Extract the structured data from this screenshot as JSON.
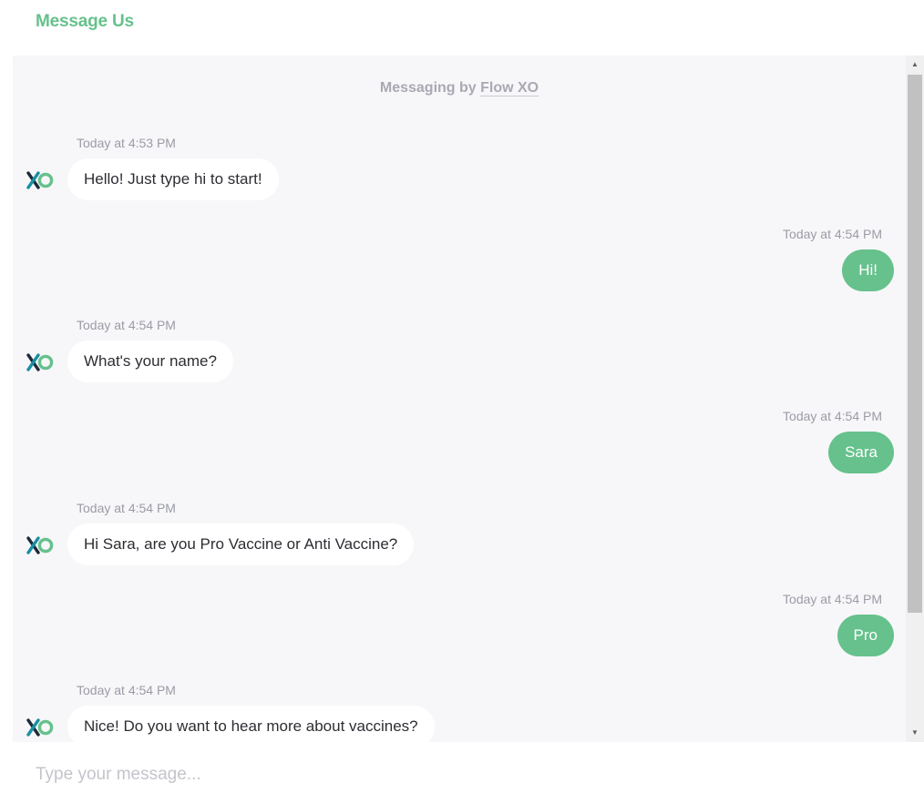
{
  "header": {
    "title": "Message Us"
  },
  "chat": {
    "powered_prefix": "Messaging by ",
    "powered_brand": "Flow XO",
    "messages": [
      {
        "sender": "bot",
        "timestamp": "Today at 4:53 PM",
        "text": "Hello! Just type hi to start!"
      },
      {
        "sender": "user",
        "timestamp": "Today at 4:54 PM",
        "text": "Hi!"
      },
      {
        "sender": "bot",
        "timestamp": "Today at 4:54 PM",
        "text": "What's your name?"
      },
      {
        "sender": "user",
        "timestamp": "Today at 4:54 PM",
        "text": "Sara"
      },
      {
        "sender": "bot",
        "timestamp": "Today at 4:54 PM",
        "text": "Hi Sara, are you Pro Vaccine or Anti Vaccine?"
      },
      {
        "sender": "user",
        "timestamp": "Today at 4:54 PM",
        "text": "Pro"
      },
      {
        "sender": "bot",
        "timestamp": "Today at 4:54 PM",
        "text": "Nice! Do you want to hear more about vaccines?"
      }
    ]
  },
  "composer": {
    "placeholder": "Type your message...",
    "value": ""
  },
  "colors": {
    "accent": "#66c18c",
    "chat_background": "#f7f7f9",
    "bot_bubble": "#ffffff",
    "logo_teal": "#1a8fa3",
    "logo_dark": "#1d2b3a"
  },
  "icons": {
    "bot_avatar": "flow-xo-logo-icon",
    "scroll_up": "triangle-up-icon",
    "scroll_down": "triangle-down-icon"
  }
}
